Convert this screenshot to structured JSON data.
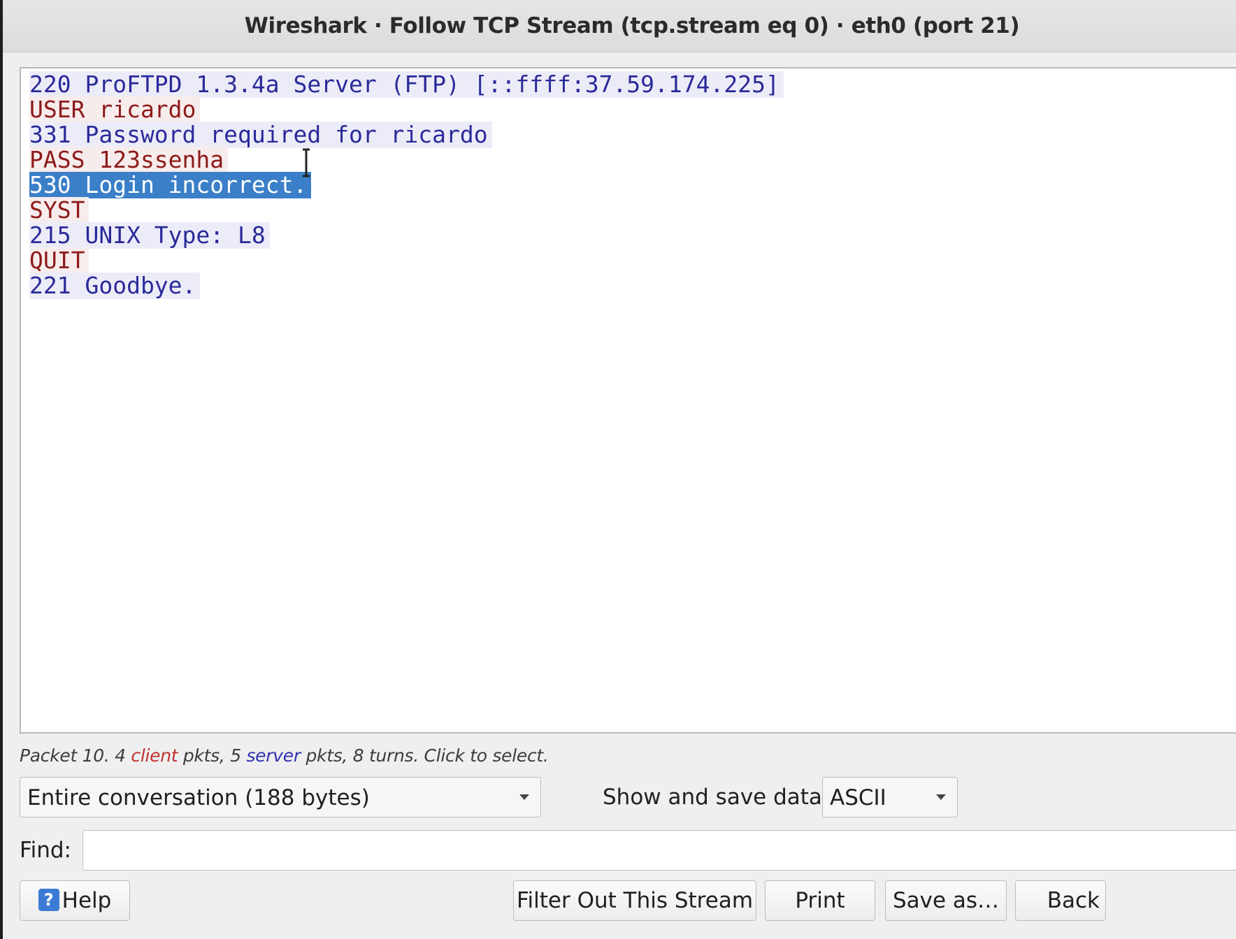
{
  "window": {
    "title": "Wireshark · Follow TCP Stream (tcp.stream eq 0) · eth0 (port 21)"
  },
  "stream": {
    "lines": [
      {
        "text": "220 ProFTPD 1.3.4a Server (FTP) [::ffff:37.59.174.225]",
        "side": "server"
      },
      {
        "text": "USER ricardo",
        "side": "client"
      },
      {
        "text": "331 Password required for ricardo",
        "side": "server"
      },
      {
        "text": "PASS 123ssenha",
        "side": "client"
      },
      {
        "text": "530 Login incorrect.",
        "side": "server",
        "selected": true
      },
      {
        "text": "SYST",
        "side": "client"
      },
      {
        "text": "215 UNIX Type: L8",
        "side": "server"
      },
      {
        "text": "QUIT",
        "side": "client"
      },
      {
        "text": "221 Goodbye.",
        "side": "server"
      }
    ]
  },
  "status": {
    "part1": "Packet 10. 4 ",
    "client_word": "client",
    "part2": " pkts, 5 ",
    "server_word": "server",
    "part3": " pkts, 8 turns. Click to select."
  },
  "conversation_select": {
    "value": "Entire conversation (188 bytes)"
  },
  "format": {
    "label": "Show and save data as",
    "value": "ASCII"
  },
  "find": {
    "label": "Find:",
    "value": ""
  },
  "buttons": {
    "help": "Help",
    "filter_out": "Filter Out This Stream",
    "print": "Print",
    "save_as": "Save as…",
    "back": "Back"
  },
  "colors": {
    "server_text": "#2a2a9a",
    "client_text": "#8e1a1a",
    "selection": "#3a7fc8"
  },
  "icons": {
    "help": "question-mark-icon",
    "cursor": "text-cursor-icon",
    "dropdown": "chevron-down-icon"
  }
}
